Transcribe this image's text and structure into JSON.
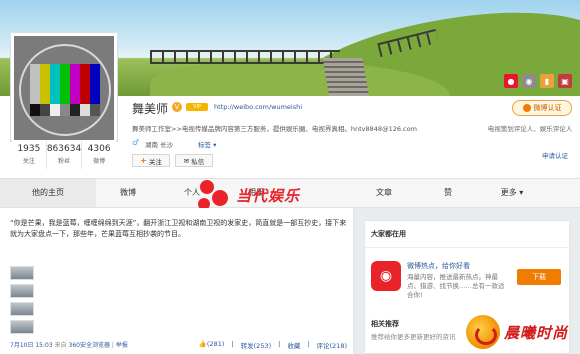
{
  "cover": {
    "icons": [
      {
        "name": "weibo-icon",
        "color": "#e6162d"
      },
      {
        "name": "chat-icon",
        "color": "#8c8c8c"
      },
      {
        "name": "mic-icon",
        "color": "#e9a23b"
      },
      {
        "name": "photo-icon",
        "color": "#c23b3b"
      }
    ]
  },
  "profile": {
    "name": "舞美师",
    "vip": "VIP",
    "url": "http://weibo.com/wumeishi",
    "desc": "舞美师工作室>>电视传媒品牌内容第三方服务，提供娱乐圈、电视界真相。hntv8848@126.com",
    "gender_icon": "♂",
    "location": "湖南 长沙",
    "tag_link": "标签 ▾",
    "follow_label": "关注",
    "message_label": "私信",
    "stats": [
      {
        "num": "1935",
        "label": "关注"
      },
      {
        "num": "863634",
        "label": "粉丝"
      },
      {
        "num": "4306",
        "label": "微博"
      }
    ],
    "verify_label": "微博认证",
    "verify_desc": "电视策划评论人、娱乐评论人",
    "verify_apply": "申请认证"
  },
  "nav": {
    "tabs": [
      "他的主页",
      "微博",
      "个人",
      "相册",
      "",
      "文章",
      "赞",
      "更多 ▾"
    ]
  },
  "watermark": {
    "text": "当代娱乐"
  },
  "post": {
    "text": "“你是芒果，我是蓝莓，缠缠绵绵到天涯”，翻开浙江卫视和湖南卫视的发家史，简直就是一部互抄史，接下来就为大家盘点一下，那些年，芒果蓝莓互相抄袭的节目。",
    "time": "7月10日 15:03",
    "source_prefix": "来自",
    "source": "360安全浏览器",
    "report": "举报",
    "actions": [
      "👍(281)",
      "转发(253)",
      "收藏",
      "评论(218)"
    ]
  },
  "sidebar": {
    "title": "大家都在用",
    "app_title": "微博热点，给你好看",
    "app_desc": "海量内容，推送最新热点。神最点、猎游、找节换……总有一款适合你!",
    "download_label": "下载",
    "related_title": "相关推荐",
    "related_desc": "推荐给你更多更新更好的资讯"
  },
  "corner": {
    "text": "晨曦时尚"
  }
}
